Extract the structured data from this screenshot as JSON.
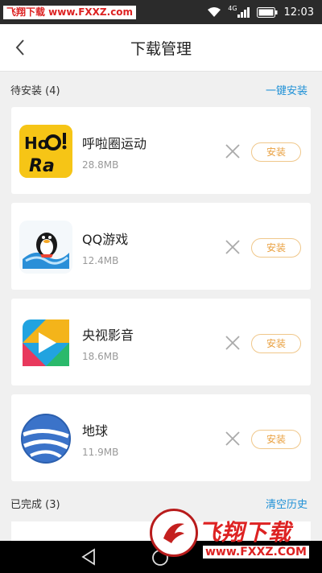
{
  "status_bar": {
    "watermark": "飞翔下载 www.FXXZ.com",
    "network": "4G",
    "time": "12:03"
  },
  "header": {
    "title": "下载管理",
    "back_icon": "chevron-left-icon"
  },
  "pending_section": {
    "title": "待安装 (4)",
    "action": "一键安装"
  },
  "apps": [
    {
      "name": "呼啦圈运动",
      "size": "28.8MB",
      "install_label": "安装",
      "icon": "hula-hoop-app-icon"
    },
    {
      "name": "QQ游戏",
      "size": "12.4MB",
      "install_label": "安装",
      "icon": "qq-game-app-icon"
    },
    {
      "name": "央视影音",
      "size": "18.6MB",
      "install_label": "安装",
      "icon": "cctv-video-app-icon"
    },
    {
      "name": "地球",
      "size": "11.9MB",
      "install_label": "安装",
      "icon": "earth-app-icon"
    }
  ],
  "completed_section": {
    "title": "已完成 (3)",
    "action": "清空历史"
  },
  "watermark": {
    "logo": "飞翔下载",
    "url": "www.FXXZ.COM"
  },
  "colors": {
    "accent": "#1e90d6",
    "install_text": "#e9a040",
    "install_border": "#f0c78a",
    "watermark": "#dd2222"
  }
}
